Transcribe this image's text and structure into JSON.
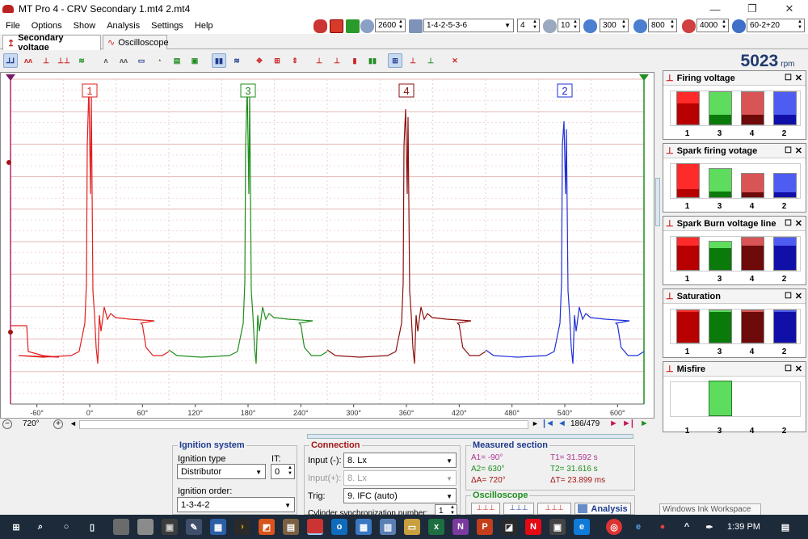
{
  "window": {
    "title": "MT Pro 4 - CRV Secondary 1.mt4 2.mt4"
  },
  "menu": [
    "File",
    "Options",
    "Show",
    "Analysis",
    "Settings",
    "Help"
  ],
  "toolbar": {
    "kv_value": "2600",
    "firing_order": "1-4-2-5-3-6",
    "cylinders": "4",
    "divisions": "10",
    "val_300": "300",
    "val_800": "800",
    "val_4000": "4000",
    "trigger_wheel": "60-2+20"
  },
  "tabs": [
    "Secondary voltage",
    "Oscilloscope"
  ],
  "rpm": {
    "value": "5023",
    "unit": "rpm"
  },
  "scope": {
    "cylinder_labels": [
      "1",
      "3",
      "4",
      "2"
    ],
    "x_ticks": [
      "-60°",
      "0°",
      "60°",
      "120°",
      "180°",
      "240°",
      "300°",
      "360°",
      "420°",
      "480°",
      "540°",
      "600°"
    ],
    "colors": {
      "cyl1": "#e02020",
      "cyl3": "#1e8e1e",
      "cyl4": "#8b1010",
      "cyl2": "#1e30d8"
    },
    "zoom": "720°",
    "position": "186/479"
  },
  "panels": [
    {
      "title": "Firing voltage",
      "labels": [
        "1",
        "3",
        "4",
        "2"
      ],
      "levels": [
        0.95,
        0.95,
        0.95,
        0.95
      ],
      "inner": [
        0.65,
        0.3,
        0.3,
        0.3
      ]
    },
    {
      "title": "Spark firing votage",
      "labels": [
        "1",
        "3",
        "4",
        "2"
      ],
      "levels": [
        0.98,
        0.85,
        0.7,
        0.7
      ],
      "inner": [
        0.25,
        0.2,
        0.2,
        0.2
      ]
    },
    {
      "title": "Spark Burn voltage line",
      "labels": [
        "1",
        "3",
        "4",
        "2"
      ],
      "levels": [
        0.95,
        0.85,
        0.95,
        0.95
      ],
      "inner": [
        0.75,
        0.75,
        0.75,
        0.75
      ]
    },
    {
      "title": "Saturation",
      "labels": [
        "1",
        "3",
        "4",
        "2"
      ],
      "levels": [
        0.95,
        0.95,
        0.95,
        0.95
      ],
      "inner": [
        0.95,
        0.95,
        0.95,
        0.95
      ]
    },
    {
      "title": "Misfire",
      "labels": [
        "1",
        "3",
        "4",
        "2"
      ],
      "levels": [
        0,
        1,
        0,
        0
      ],
      "inner": [
        0,
        0,
        0,
        0
      ]
    }
  ],
  "ignition": {
    "title": "Ignition system",
    "type_label": "Ignition type",
    "type_value": "Distributor",
    "it_label": "IT:",
    "it_value": "0",
    "order_label": "Ignition order:",
    "order_value": "1-3-4-2"
  },
  "connection": {
    "title": "Connection",
    "input_minus_label": "Input (-):",
    "input_minus_value": "8. Lx",
    "input_plus_label": "Input(+):",
    "input_plus_value": "8. Lx",
    "trig_label": "Trig:",
    "trig_value": "9. IFC (auto)",
    "sync_label": "Cylinder synchronization number:",
    "sync_value": "1"
  },
  "measured": {
    "title": "Measured section",
    "a1": "A1= -90°",
    "a2": "A2= 630°",
    "da": "ΔA= 720°",
    "t1": "T1= 31.592 s",
    "t2": "T2= 31.616 s",
    "dt": "ΔT= 23.899 ms"
  },
  "oscilloscope_group": {
    "title": "Oscilloscope",
    "analysis_label": "Analysis"
  },
  "tooltip": "Windows Ink Workspace",
  "taskbar": {
    "time": "1:39 PM"
  }
}
